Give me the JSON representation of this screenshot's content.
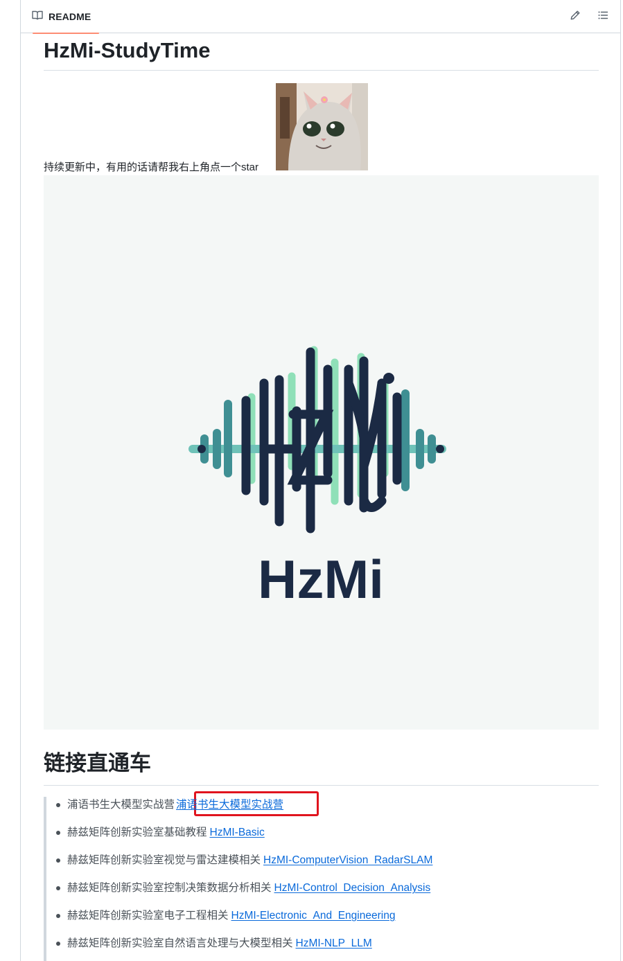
{
  "tabbar": {
    "readme_label": "README",
    "edit_icon": "pencil-icon",
    "outline_icon": "list-unordered-icon"
  },
  "readme": {
    "title": "HzMi-StudyTime",
    "star_text": "持续更新中，有用的话请帮我右上角点一个star",
    "logo_wordmark": "HzMi"
  },
  "links_section": {
    "heading": "链接直通车",
    "items": [
      {
        "text": "浦语书生大模型实战营",
        "link": "浦语书生大模型实战营"
      },
      {
        "text": "赫兹矩阵创新实验室基础教程",
        "link": "HzMI-Basic"
      },
      {
        "text": "赫兹矩阵创新实验室视觉与雷达建模相关",
        "link": "HzMI-ComputerVision_RadarSLAM"
      },
      {
        "text": "赫兹矩阵创新实验室控制决策数据分析相关",
        "link": "HzMI-Control_Decision_Analysis"
      },
      {
        "text": "赫兹矩阵创新实验室电子工程相关",
        "link": "HzMI-Electronic_And_Engineering"
      },
      {
        "text": "赫兹矩阵创新实验室自然语言处理与大模型相关",
        "link": "HzMI-NLP_LLM"
      }
    ]
  },
  "colors": {
    "tab_underline": "#fd8c73",
    "link": "#0969da",
    "highlight_box": "#e0141e",
    "logo_navy": "#1b2a44",
    "logo_teal": "#3f8f93",
    "logo_mint": "#8fe0b8"
  }
}
